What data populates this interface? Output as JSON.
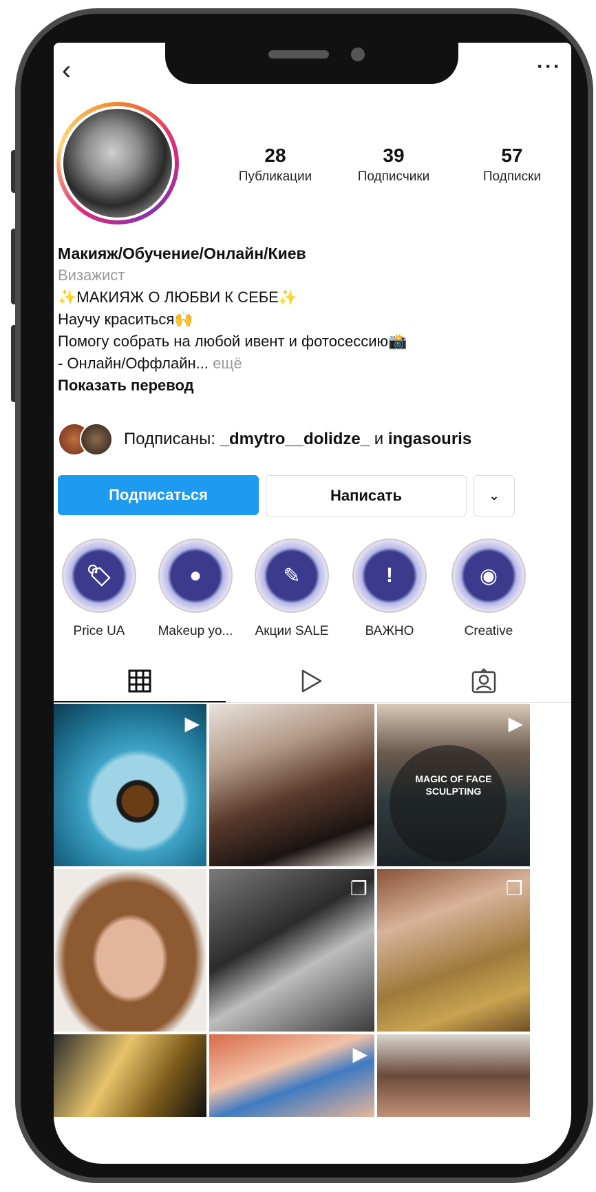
{
  "header": {
    "back_icon": "chevron-left-icon",
    "more_label": "···"
  },
  "profile": {
    "stats": [
      {
        "value": "28",
        "label": "Публикации"
      },
      {
        "value": "39",
        "label": "Подписчики"
      },
      {
        "value": "57",
        "label": "Подписки"
      }
    ],
    "name": "Макияж/Обучение/Онлайн/Киев",
    "category": "Визажист",
    "bio_lines": [
      "✨МАКИЯЖ О ЛЮБВИ К СЕБЕ✨",
      "Научу краситься🙌",
      "Помогу собрать на любой ивент и фотосессию📸"
    ],
    "bio_last": "- Онлайн/Оффлайн...",
    "bio_more": " ещё",
    "translate": "Показать перевод"
  },
  "followed_by": {
    "prefix": "Подписаны: ",
    "user1": "_dmytro__dolidze_",
    "joiner": " и ",
    "user2": "ingasouris"
  },
  "actions": {
    "follow": "Подписаться",
    "message": "Написать",
    "dropdown": "⌄"
  },
  "highlights": [
    {
      "label": "Price UA",
      "icon": "price-tag-icon",
      "glyph": "🏷"
    },
    {
      "label": "Makeup yo...",
      "icon": "makeup-icon",
      "glyph": "●"
    },
    {
      "label": "Акции SALE",
      "icon": "brush-icon",
      "glyph": "✎"
    },
    {
      "label": "ВАЖНО",
      "icon": "exclamation-icon",
      "glyph": "!"
    },
    {
      "label": "Creative",
      "icon": "lips-icon",
      "glyph": "◉"
    }
  ],
  "tabs": [
    {
      "name": "grid",
      "icon": "grid-icon"
    },
    {
      "name": "reels",
      "icon": "play-icon"
    },
    {
      "name": "tagged",
      "icon": "tagged-person-icon"
    }
  ],
  "grid": {
    "caption_post3_line1": "MAGIC OF FACE",
    "caption_post3_line2": "SCULPTING"
  }
}
